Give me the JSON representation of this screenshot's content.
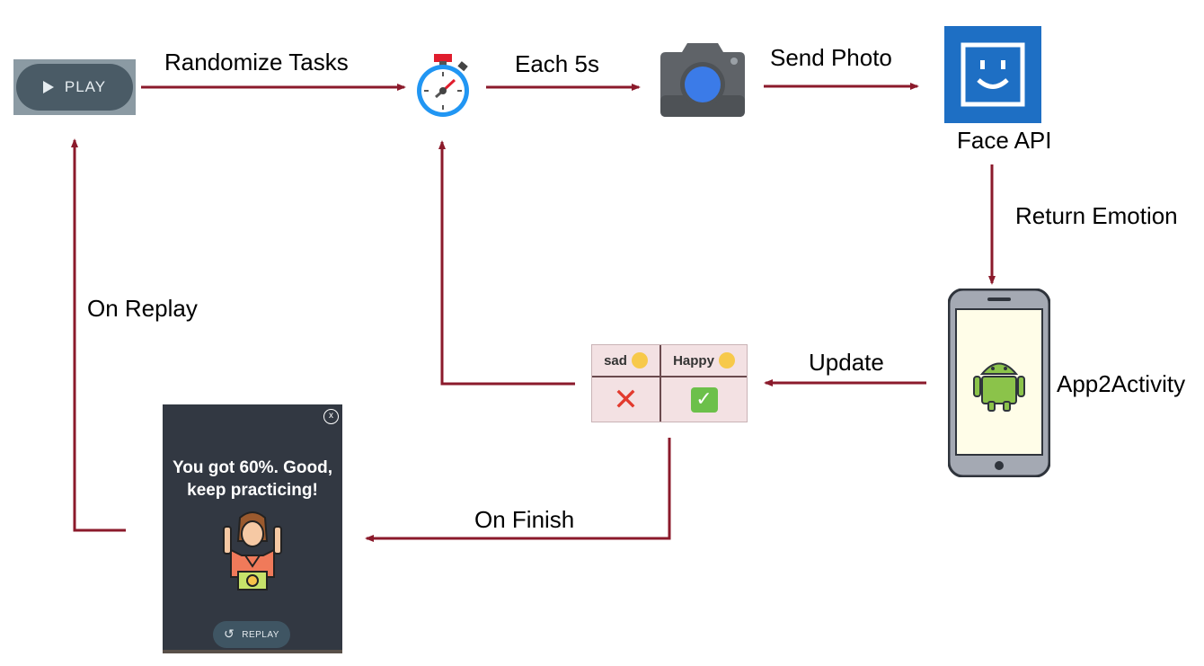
{
  "colors": {
    "arrow": "#8b1a2b",
    "face_api": "#1e6fc4",
    "card_bg": "#323842"
  },
  "play_button": {
    "label": "PLAY",
    "icon": "play-triangle-icon"
  },
  "timer": {
    "icon": "stopwatch-icon"
  },
  "camera": {
    "icon": "camera-icon"
  },
  "face_api": {
    "icon": "smiley-face-icon",
    "label": "Face API"
  },
  "phone": {
    "icon": "android-robot-icon",
    "label": "App2Activity"
  },
  "edges": {
    "randomize": "Randomize Tasks",
    "each5s": "Each 5s",
    "send_photo": "Send Photo",
    "return_emotion": "Return Emotion",
    "update": "Update",
    "on_finish": "On Finish",
    "on_replay": "On Replay"
  },
  "emotion_grid": {
    "headers": [
      "sad",
      "Happy"
    ],
    "results": [
      "cross-mark-icon",
      "check-mark-icon"
    ]
  },
  "result_card": {
    "close": "x",
    "message": "You got 60%. Good,\nkeep practicing!",
    "replay_label": "REPLAY",
    "illustration": "winner-with-medal-icon"
  }
}
